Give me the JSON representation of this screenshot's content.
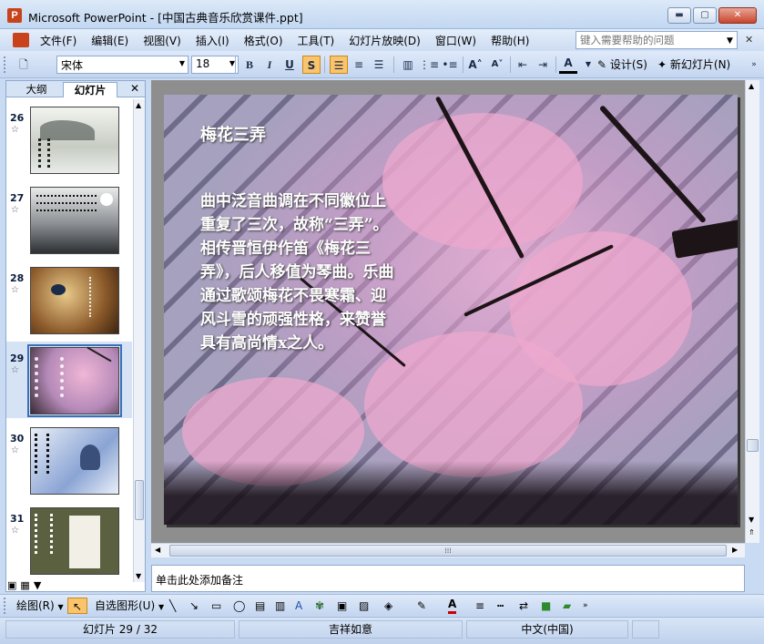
{
  "window": {
    "app_name": "Microsoft PowerPoint",
    "title": "Microsoft PowerPoint - [中国古典音乐欣赏课件.ppt]",
    "app_icon_glyph": "P",
    "minimize_glyph": "▬",
    "maximize_glyph": "▢",
    "close_glyph": "✕"
  },
  "menu": {
    "items": [
      "文件(F)",
      "编辑(E)",
      "视图(V)",
      "插入(I)",
      "格式(O)",
      "工具(T)",
      "幻灯片放映(D)",
      "窗口(W)",
      "帮助(H)"
    ],
    "help_placeholder": "键入需要帮助的问题",
    "close_glyph": "✕"
  },
  "toolbar": {
    "font_name": "宋体",
    "font_size": "18",
    "bold": "B",
    "italic": "I",
    "underline": "U",
    "shadow": "S",
    "font_color_glyph": "A",
    "design_label": "设计(S)",
    "new_slide_label": "新幻灯片(N)"
  },
  "left_pane": {
    "tab_outline": "大纲",
    "tab_slides": "幻灯片",
    "close_glyph": "✕",
    "thumbnails": [
      {
        "number": "26",
        "theme": "ink-landscape"
      },
      {
        "number": "27",
        "theme": "ink-mountains"
      },
      {
        "number": "28",
        "theme": "autumn-poster"
      },
      {
        "number": "29",
        "theme": "plum-blossom",
        "selected": true
      },
      {
        "number": "30",
        "theme": "blue-snow-portrait"
      },
      {
        "number": "31",
        "theme": "green-scroll"
      }
    ],
    "star_glyph": "☆"
  },
  "slide": {
    "title": "梅花三弄",
    "body": "曲中泛音曲调在不同徽位上重复了三次，故称“三弄”。 相传晋恒伊作笛《梅花三弄》，后人移值为琴曲。乐曲通过歌颂梅花不畏寒霜、迎风斗雪的顽强性格，来赞誉具有高尚情x之人。",
    "background_colors": {
      "blossom": "#eea8cd",
      "sky": "#a7a4bf",
      "branch": "#1c1416"
    }
  },
  "notes": {
    "placeholder": "单击此处添加备注"
  },
  "draw_toolbar": {
    "draw_label": "绘图(R)",
    "autoshape_label": "自选图形(U)"
  },
  "status": {
    "slide_position": "幻灯片 29 / 32",
    "design_name": "吉祥如意",
    "language": "中文(中国)"
  }
}
